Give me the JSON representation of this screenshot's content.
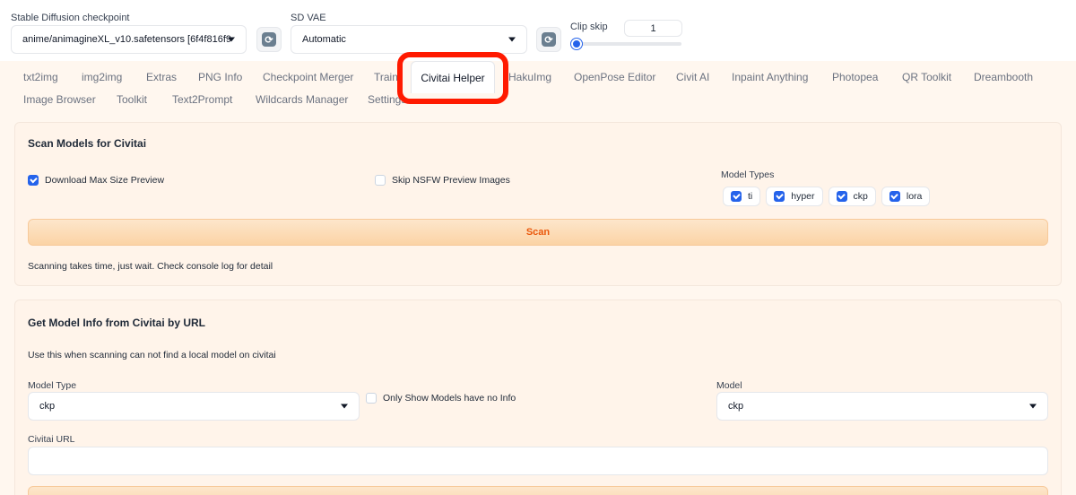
{
  "top": {
    "checkpoint_label": "Stable Diffusion checkpoint",
    "checkpoint_value": "anime/animagineXL_v10.safetensors [6f4f816f9",
    "vae_label": "SD VAE",
    "vae_value": "Automatic",
    "clip_label": "Clip skip",
    "clip_value": "1",
    "clip_slider_fraction": 0.0
  },
  "tabs_row1": [
    "txt2img",
    "img2img",
    "Extras",
    "PNG Info",
    "Checkpoint Merger",
    "Train",
    "Civitai Helper",
    "HakuImg",
    "OpenPose Editor",
    "Civit AI",
    "Inpaint Anything",
    "Photopea",
    "QR Toolkit",
    "Dreambooth"
  ],
  "tabs_row2": [
    "Image Browser",
    "Toolkit",
    "Text2Prompt",
    "Wildcards Manager",
    "Settings"
  ],
  "active_tab": "Civitai Helper",
  "scan": {
    "title": "Scan Models for Civitai",
    "download_max_label": "Download Max Size Preview",
    "download_max_checked": true,
    "skip_nsfw_label": "Skip NSFW Preview Images",
    "skip_nsfw_checked": false,
    "model_types_label": "Model Types",
    "model_types": [
      {
        "label": "ti",
        "checked": true
      },
      {
        "label": "hyper",
        "checked": true
      },
      {
        "label": "ckp",
        "checked": true
      },
      {
        "label": "lora",
        "checked": true
      }
    ],
    "button": "Scan",
    "note": "Scanning takes time, just wait. Check console log for detail"
  },
  "get_info": {
    "title": "Get Model Info from Civitai by URL",
    "desc": "Use this when scanning can not find a local model on civitai",
    "model_type_label": "Model Type",
    "model_type_value": "ckp",
    "only_show_label": "Only Show Models have no Info",
    "only_show_checked": false,
    "model_label": "Model",
    "model_value": "ckp",
    "url_label": "Civitai URL",
    "url_value": ""
  },
  "colors": {
    "accent": "#2563eb",
    "highlight": "#ff1a00",
    "scan_text": "#ea580c"
  }
}
